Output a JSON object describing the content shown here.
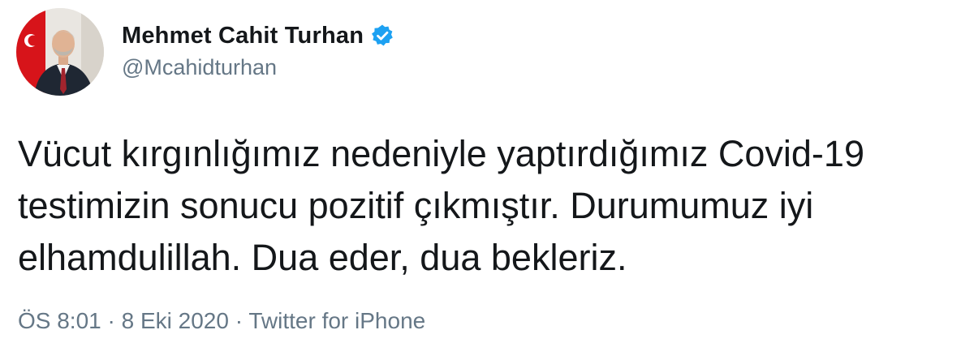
{
  "author": {
    "display_name": "Mehmet Cahit Turhan",
    "handle": "@Mcahidturhan",
    "verified": true
  },
  "tweet": {
    "text": "Vücut kırgınlığımız nedeniyle yaptırdığımız Covid-19\ntestimizin sonucu pozitif çıkmıştır. Durumumuz iyi\nelhamdulillah. Dua eder, dua bekleriz."
  },
  "meta": {
    "time": "ÖS 8:01",
    "separator": "·",
    "date": "8 Eki 2020",
    "source": "Twitter for iPhone"
  },
  "colors": {
    "verified_badge": "#1da1f2",
    "secondary_text": "#657786",
    "primary_text": "#14171a"
  }
}
